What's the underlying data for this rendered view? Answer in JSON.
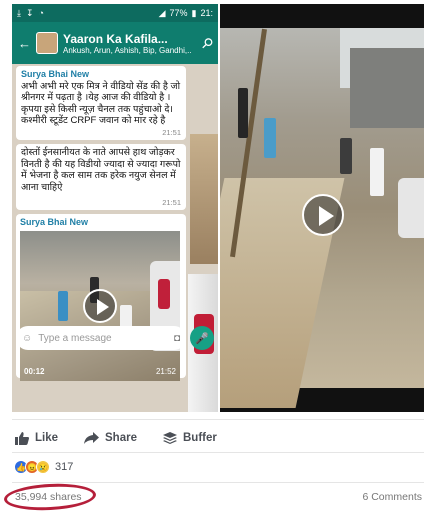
{
  "whatsapp": {
    "status": {
      "battery": "77%",
      "time": "21:"
    },
    "group_name": "Yaaron Ka Kafila...",
    "members": "Ankush, Arun, Ashish, Bip, Gandhi,..",
    "messages": [
      {
        "sender": "Surya Bhai New",
        "text": "अभी अभी मरे एक मित्र ने वीडियो सेंड की है जो श्रीनगर में पढ़ता है ।येह आज की वीडियो है । कृपया इसे किसी न्यूज़ चैनल तक पहुंचाओ दे। कश्मीरी स्टूडेंट CRPF जवान को मार रहे है",
        "time": "21:51"
      },
      {
        "text": "दोस्तों ईनसानीयत के नाते आपसे हाथ जोड़कर विनती है की यह विडीयो ज्यादा से ज्यादा गरूपो में भेजना है कल साम तक हरेक नयुज सेनल में आना चाहिऐ",
        "time": "21:51"
      },
      {
        "sender": "Surya Bhai New",
        "duration": "00:12",
        "time": "21:52"
      }
    ],
    "composer_placeholder": "Type a message"
  },
  "post_actions": {
    "like": "Like",
    "share": "Share",
    "buffer": "Buffer"
  },
  "reactions": {
    "count": "317"
  },
  "footer": {
    "shares": "35,994 shares",
    "comments": "6 Comments"
  },
  "colors": {
    "whatsapp_header": "#0f7d6e",
    "facebook_blue": "#2f6ce0",
    "highlight_ring": "#b51f3a"
  }
}
